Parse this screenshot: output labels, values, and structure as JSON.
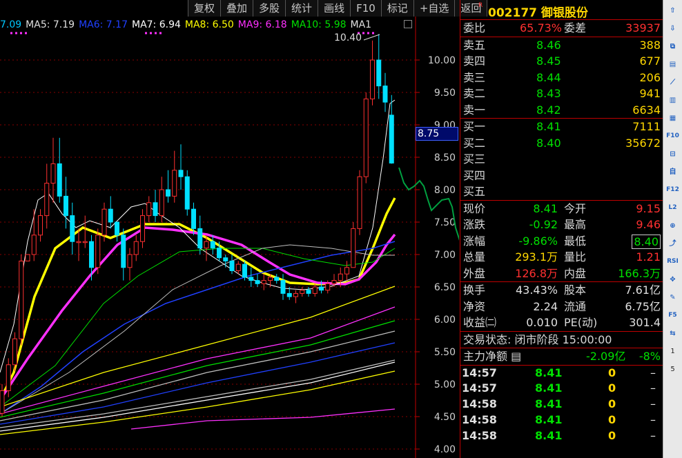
{
  "toolbar": [
    "复权",
    "叠加",
    "多股",
    "统计",
    "画线",
    "F10",
    "标记",
    "+自选",
    "返回"
  ],
  "ma_legend": [
    {
      "text": "7.09",
      "color": "#00c8ff"
    },
    {
      "text": "MA5: 7.19",
      "color": "#e0e0e0"
    },
    {
      "text": "MA6: 7.17",
      "color": "#2040ff"
    },
    {
      "text": "MA7: 6.94",
      "color": "#ffffff"
    },
    {
      "text": "MA8: 6.50",
      "color": "#ffff00"
    },
    {
      "text": "MA9: 6.18",
      "color": "#ff30ff"
    },
    {
      "text": "MA10: 5.98",
      "color": "#00e000"
    },
    {
      "text": "MA1",
      "color": "#e0e0e0"
    }
  ],
  "chart": {
    "y_ticks": [
      "10.00",
      "9.50",
      "9.00",
      "8.50",
      "8.00",
      "7.50",
      "7.00",
      "6.50",
      "6.00",
      "5.50",
      "5.00",
      "4.50",
      "4.00"
    ],
    "current_price_label": "8.75",
    "peak_label": "10.40",
    "up_color": "#ff3030",
    "down_color": "#00e0ff",
    "candles": [
      {
        "o": 4.55,
        "h": 5.0,
        "l": 4.5,
        "c": 4.9
      },
      {
        "o": 4.9,
        "h": 5.4,
        "l": 4.8,
        "c": 5.3
      },
      {
        "o": 5.3,
        "h": 5.8,
        "l": 5.2,
        "c": 5.7
      },
      {
        "o": 5.7,
        "h": 7.0,
        "l": 5.6,
        "c": 6.9
      },
      {
        "o": 6.9,
        "h": 7.0,
        "l": 6.9,
        "c": 7.0
      },
      {
        "o": 7.0,
        "h": 7.7,
        "l": 6.9,
        "c": 7.3
      },
      {
        "o": 7.3,
        "h": 7.7,
        "l": 7.2,
        "c": 7.6
      },
      {
        "o": 7.6,
        "h": 8.4,
        "l": 7.4,
        "c": 8.1
      },
      {
        "o": 8.1,
        "h": 8.8,
        "l": 7.8,
        "c": 8.4
      },
      {
        "o": 8.4,
        "h": 8.8,
        "l": 7.8,
        "c": 7.9
      },
      {
        "o": 7.9,
        "h": 8.2,
        "l": 7.4,
        "c": 7.6
      },
      {
        "o": 7.6,
        "h": 7.8,
        "l": 7.0,
        "c": 7.2
      },
      {
        "o": 7.2,
        "h": 7.4,
        "l": 6.9,
        "c": 7.2
      },
      {
        "o": 7.2,
        "h": 7.6,
        "l": 7.1,
        "c": 7.2
      },
      {
        "o": 7.2,
        "h": 7.3,
        "l": 6.6,
        "c": 6.8
      },
      {
        "o": 6.8,
        "h": 7.4,
        "l": 6.7,
        "c": 7.3
      },
      {
        "o": 7.3,
        "h": 7.8,
        "l": 7.2,
        "c": 7.7
      },
      {
        "o": 7.7,
        "h": 7.9,
        "l": 7.4,
        "c": 7.5
      },
      {
        "o": 7.5,
        "h": 7.5,
        "l": 7.2,
        "c": 7.3
      },
      {
        "o": 7.3,
        "h": 7.4,
        "l": 6.6,
        "c": 6.8
      },
      {
        "o": 6.8,
        "h": 7.1,
        "l": 6.6,
        "c": 7.0
      },
      {
        "o": 7.0,
        "h": 7.3,
        "l": 6.9,
        "c": 7.2
      },
      {
        "o": 7.2,
        "h": 7.7,
        "l": 7.1,
        "c": 7.6
      },
      {
        "o": 7.6,
        "h": 7.9,
        "l": 7.5,
        "c": 7.8
      },
      {
        "o": 7.8,
        "h": 8.0,
        "l": 7.5,
        "c": 7.6
      },
      {
        "o": 7.6,
        "h": 8.2,
        "l": 7.5,
        "c": 8.0
      },
      {
        "o": 8.0,
        "h": 8.3,
        "l": 7.8,
        "c": 7.9
      },
      {
        "o": 7.9,
        "h": 8.6,
        "l": 7.8,
        "c": 8.3
      },
      {
        "o": 8.3,
        "h": 8.7,
        "l": 8.0,
        "c": 8.2
      },
      {
        "o": 8.2,
        "h": 8.3,
        "l": 7.6,
        "c": 7.7
      },
      {
        "o": 7.7,
        "h": 7.8,
        "l": 7.3,
        "c": 7.4
      },
      {
        "o": 7.4,
        "h": 7.6,
        "l": 7.0,
        "c": 7.1
      },
      {
        "o": 7.1,
        "h": 7.3,
        "l": 6.9,
        "c": 7.2
      },
      {
        "o": 7.2,
        "h": 7.3,
        "l": 7.0,
        "c": 7.1
      },
      {
        "o": 7.1,
        "h": 7.2,
        "l": 6.9,
        "c": 6.95
      },
      {
        "o": 6.95,
        "h": 7.0,
        "l": 6.8,
        "c": 6.9
      },
      {
        "o": 6.9,
        "h": 7.0,
        "l": 6.7,
        "c": 6.75
      },
      {
        "o": 6.75,
        "h": 6.9,
        "l": 6.7,
        "c": 6.85
      },
      {
        "o": 6.85,
        "h": 6.9,
        "l": 6.6,
        "c": 6.65
      },
      {
        "o": 6.65,
        "h": 6.8,
        "l": 6.5,
        "c": 6.6
      },
      {
        "o": 6.6,
        "h": 6.7,
        "l": 6.5,
        "c": 6.55
      },
      {
        "o": 6.55,
        "h": 6.7,
        "l": 6.45,
        "c": 6.6
      },
      {
        "o": 6.6,
        "h": 6.7,
        "l": 6.5,
        "c": 6.65
      },
      {
        "o": 6.65,
        "h": 6.7,
        "l": 6.55,
        "c": 6.6
      },
      {
        "o": 6.6,
        "h": 6.7,
        "l": 6.3,
        "c": 6.4
      },
      {
        "o": 6.4,
        "h": 6.5,
        "l": 6.3,
        "c": 6.35
      },
      {
        "o": 6.35,
        "h": 6.45,
        "l": 6.25,
        "c": 6.4
      },
      {
        "o": 6.4,
        "h": 6.5,
        "l": 6.35,
        "c": 6.45
      },
      {
        "o": 6.45,
        "h": 6.5,
        "l": 6.35,
        "c": 6.4
      },
      {
        "o": 6.4,
        "h": 6.55,
        "l": 6.35,
        "c": 6.5
      },
      {
        "o": 6.5,
        "h": 6.6,
        "l": 6.4,
        "c": 6.45
      },
      {
        "o": 6.45,
        "h": 6.6,
        "l": 6.4,
        "c": 6.55
      },
      {
        "o": 6.55,
        "h": 6.7,
        "l": 6.5,
        "c": 6.6
      },
      {
        "o": 6.6,
        "h": 6.8,
        "l": 6.5,
        "c": 6.7
      },
      {
        "o": 6.7,
        "h": 6.9,
        "l": 6.6,
        "c": 6.8
      },
      {
        "o": 6.8,
        "h": 7.5,
        "l": 6.8,
        "c": 7.4
      },
      {
        "o": 7.4,
        "h": 8.3,
        "l": 7.3,
        "c": 8.2
      },
      {
        "o": 8.2,
        "h": 9.5,
        "l": 8.1,
        "c": 9.4
      },
      {
        "o": 9.4,
        "h": 10.3,
        "l": 9.3,
        "c": 10.0
      },
      {
        "o": 10.0,
        "h": 10.4,
        "l": 9.4,
        "c": 9.6
      },
      {
        "o": 9.6,
        "h": 9.8,
        "l": 9.2,
        "c": 9.35
      },
      {
        "o": 9.15,
        "h": 9.46,
        "l": 8.4,
        "c": 8.41
      }
    ]
  },
  "stock": {
    "flag": "R",
    "code": "002177",
    "name": "御银股份"
  },
  "order_book": {
    "ratio_label": "委比",
    "ratio_value": "65.73%",
    "diff_label": "委差",
    "diff_value": "33937",
    "asks": [
      {
        "label": "卖五",
        "price": "8.46",
        "vol": "388"
      },
      {
        "label": "卖四",
        "price": "8.45",
        "vol": "677"
      },
      {
        "label": "卖三",
        "price": "8.44",
        "vol": "206"
      },
      {
        "label": "卖二",
        "price": "8.43",
        "vol": "941"
      },
      {
        "label": "卖一",
        "price": "8.42",
        "vol": "6634"
      }
    ],
    "bids": [
      {
        "label": "买一",
        "price": "8.41",
        "vol": "7111"
      },
      {
        "label": "买二",
        "price": "8.40",
        "vol": "35672"
      },
      {
        "label": "买三",
        "price": "",
        "vol": ""
      },
      {
        "label": "买四",
        "price": "",
        "vol": ""
      },
      {
        "label": "买五",
        "price": "",
        "vol": ""
      }
    ]
  },
  "quote": [
    {
      "l1": "现价",
      "v1": "8.41",
      "c1": "dn",
      "l2": "今开",
      "v2": "9.15",
      "c2": "up"
    },
    {
      "l1": "涨跌",
      "v1": "-0.92",
      "c1": "dn",
      "l2": "最高",
      "v2": "9.46",
      "c2": "up"
    },
    {
      "l1": "涨幅",
      "v1": "-9.86%",
      "c1": "dn",
      "l2": "最低",
      "v2": "8.40",
      "c2": "dn"
    },
    {
      "l1": "总量",
      "v1": "293.1万",
      "c1": "yl",
      "l2": "量比",
      "v2": "1.21",
      "c2": "up"
    },
    {
      "l1": "外盘",
      "v1": "126.8万",
      "c1": "up",
      "l2": "内盘",
      "v2": "166.3万",
      "c2": "dn"
    }
  ],
  "fundamentals": [
    {
      "l1": "换手",
      "v1": "43.43%",
      "l2": "股本",
      "v2": "7.61亿"
    },
    {
      "l1": "净资",
      "v1": "2.24",
      "l2": "流通",
      "v2": "6.75亿"
    },
    {
      "l1": "收益㈡",
      "v1": "0.010",
      "l2": "PE(动)",
      "v2": "301.4"
    }
  ],
  "trade_status": "交易状态: 闭市阶段 15:00:00",
  "main_force": {
    "label": "主力净额",
    "value": "-2.09亿",
    "pct": "-8%"
  },
  "ticks": [
    {
      "time": "14:57",
      "price": "8.41",
      "vol": "0",
      "dir": "–"
    },
    {
      "time": "14:57",
      "price": "8.41",
      "vol": "0",
      "dir": "–"
    },
    {
      "time": "14:58",
      "price": "8.41",
      "vol": "0",
      "dir": "–"
    },
    {
      "time": "14:58",
      "price": "8.41",
      "vol": "0",
      "dir": "–"
    },
    {
      "time": "14:58",
      "price": "8.41",
      "vol": "0",
      "dir": "–"
    }
  ],
  "sidebar": [
    {
      "name": "arrow-up-icon",
      "text": "⇧"
    },
    {
      "name": "arrow-down-icon",
      "text": "⇩"
    },
    {
      "name": "minute-chart-icon",
      "text": "⧉"
    },
    {
      "name": "kline-chart-icon",
      "text": "▤"
    },
    {
      "name": "trend-line-icon",
      "text": "⟋"
    },
    {
      "name": "candle-icon",
      "text": "▥"
    },
    {
      "name": "multi-window-icon",
      "text": "▦"
    },
    {
      "name": "f10-icon",
      "text": "F10"
    },
    {
      "name": "info-icon",
      "text": "⊟"
    },
    {
      "name": "self-select-icon",
      "text": "自"
    },
    {
      "name": "f12-icon",
      "text": "F12"
    },
    {
      "name": "level2-icon",
      "text": "L2"
    },
    {
      "name": "refresh-icon",
      "text": "⊕"
    },
    {
      "name": "trend-icon",
      "text": "⤴"
    },
    {
      "name": "rsi-icon",
      "text": "RSI"
    },
    {
      "name": "move-icon",
      "text": "✥"
    },
    {
      "name": "pen-icon",
      "text": "✎"
    },
    {
      "name": "f5-icon",
      "text": "F5"
    },
    {
      "name": "switch-icon",
      "text": "⇆"
    },
    {
      "name": "page-one-label",
      "text": "1"
    },
    {
      "name": "page-five-label",
      "text": "5"
    }
  ]
}
